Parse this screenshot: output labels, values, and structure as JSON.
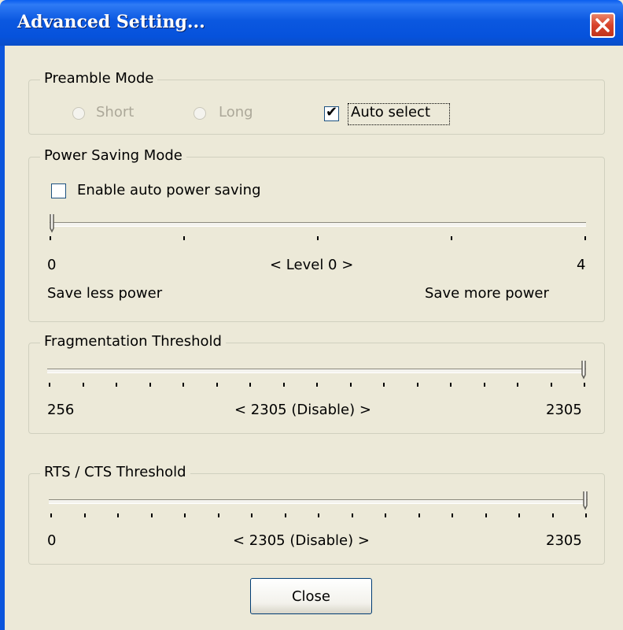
{
  "window": {
    "title": "Advanced Setting...",
    "close_icon": "close-icon",
    "title_color": "#0B58E0",
    "close_color": "#D8432A"
  },
  "preamble": {
    "legend": "Preamble Mode",
    "options": [
      {
        "label": "Short",
        "selected": false,
        "enabled": false
      },
      {
        "label": "Long",
        "selected": false,
        "enabled": false
      }
    ],
    "auto_select": {
      "label": "Auto select",
      "checked": true
    }
  },
  "power_saving": {
    "legend": "Power Saving Mode",
    "enable": {
      "label": "Enable auto power saving",
      "checked": false
    },
    "min_label": "0",
    "max_label": "4",
    "level_label": "< Level 0 >",
    "left_caption": "Save less power",
    "right_caption": "Save more power",
    "slider_value": 0,
    "slider_min": 0,
    "slider_max": 4
  },
  "fragmentation": {
    "legend": "Fragmentation Threshold",
    "min_label": "256",
    "max_label": "2305",
    "value_label": "< 2305 (Disable) >",
    "slider_value": 2305,
    "slider_min": 256,
    "slider_max": 2305
  },
  "rts_cts": {
    "legend": "RTS / CTS Threshold",
    "min_label": "0",
    "max_label": "2305",
    "value_label": "< 2305 (Disable) >",
    "slider_value": 2305,
    "slider_min": 0,
    "slider_max": 2305
  },
  "close_button": {
    "label": "Close"
  }
}
